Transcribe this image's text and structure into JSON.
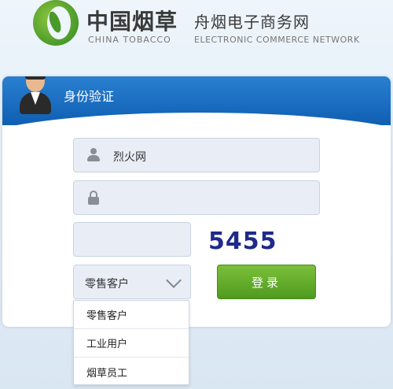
{
  "header": {
    "brand_cn": "中国烟草",
    "brand_en": "CHINA TOBACCO",
    "site_cn": "舟烟电子商务网",
    "site_en": "ELECTRONIC COMMERCE NETWORK"
  },
  "panel": {
    "title": "身份验证"
  },
  "form": {
    "username_value": "烈火网",
    "password_value": "",
    "captcha_input_value": "",
    "captcha_code": "5455",
    "role_selected": "零售客户",
    "login_label": "登录"
  },
  "dropdown": {
    "options": [
      "零售客户",
      "工业用户",
      "烟草员工"
    ]
  },
  "colors": {
    "header_blue": "#0f5fb3",
    "login_green": "#4f9a1f",
    "captcha_text": "#1f2a8c"
  },
  "icons": {
    "user": "user-icon",
    "password": "lock-icon",
    "select": "chevron-down-icon"
  }
}
